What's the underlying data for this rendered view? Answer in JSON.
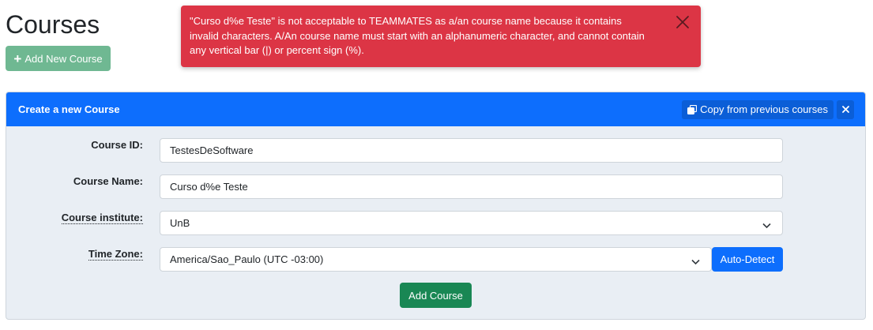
{
  "page": {
    "title": "Courses",
    "add_new_course_label": "Add New Course"
  },
  "alert": {
    "message": "\"Curso d%e Teste\" is not acceptable to TEAMMATES as a/an course name because it contains invalid characters. A/An course name must start with an alphanumeric character, and cannot contain any vertical bar (|) or percent sign (%).",
    "color": "#dc3545"
  },
  "panel": {
    "title": "Create a new Course",
    "copy_label": "Copy from previous courses",
    "close_symbol": "×"
  },
  "form": {
    "course_id_label": "Course ID:",
    "course_id_value": "TestesDeSoftware",
    "course_name_label": "Course Name:",
    "course_name_value": "Curso d%e Teste",
    "institute_label": "Course institute:",
    "institute_value": "UnB",
    "timezone_label": "Time Zone:",
    "timezone_value": "America/Sao_Paulo (UTC -03:00)",
    "auto_detect_label": "Auto-Detect",
    "submit_label": "Add Course"
  },
  "colors": {
    "primary": "#0d6efd",
    "success": "#198754",
    "danger": "#dc3545"
  }
}
